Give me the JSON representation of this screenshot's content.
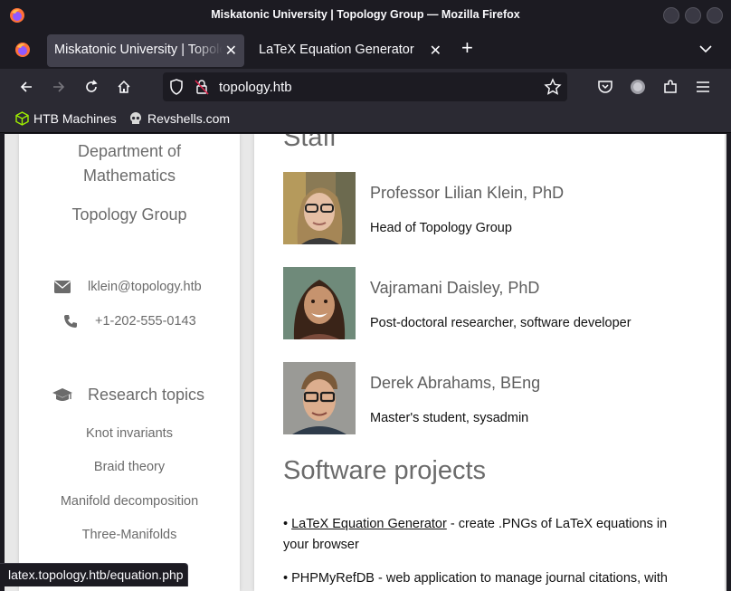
{
  "window": {
    "title": "Miskatonic University | Topology Group — Mozilla Firefox"
  },
  "tabs": [
    {
      "label": "Miskatonic University | Topology Group",
      "active": true
    },
    {
      "label": "LaTeX Equation Generator",
      "active": false
    }
  ],
  "navbar": {
    "url": "topology.htb"
  },
  "bookmarks": [
    {
      "label": "HTB Machines",
      "icon": "cube-icon"
    },
    {
      "label": "Revshells.com",
      "icon": "skull-icon"
    }
  ],
  "sidebar": {
    "department": "Department of Mathematics",
    "group": "Topology Group",
    "email": "lklein@topology.htb",
    "phone": "+1-202-555-0143",
    "research_heading": "Research topics",
    "topics": [
      "Knot invariants",
      "Braid theory",
      "Manifold decomposition",
      "Three-Manifolds"
    ]
  },
  "main": {
    "staff_heading": "Staff",
    "staff": [
      {
        "name": "Professor Lilian Klein, PhD",
        "role": "Head of Topology Group"
      },
      {
        "name": "Vajramani Daisley, PhD",
        "role": "Post-doctoral researcher, software developer"
      },
      {
        "name": "Derek Abrahams, BEng",
        "role": "Master's student, sysadmin"
      }
    ],
    "projects_heading": "Software projects",
    "projects": [
      {
        "link": "LaTeX Equation Generator",
        "text": " - create .PNGs of LaTeX equations in your browser"
      },
      {
        "link": "",
        "text": "PHPMyRefDB - web application to manage journal citations, with"
      }
    ]
  },
  "statusbar": {
    "text": "latex.topology.htb/equation.php"
  },
  "colors": {
    "chrome_dark": "#1c1b22",
    "toolbar": "#2b2a33",
    "tab_active": "#42414d",
    "page_bg": "#e8e8e8",
    "muted_text": "#6b6b6b"
  }
}
